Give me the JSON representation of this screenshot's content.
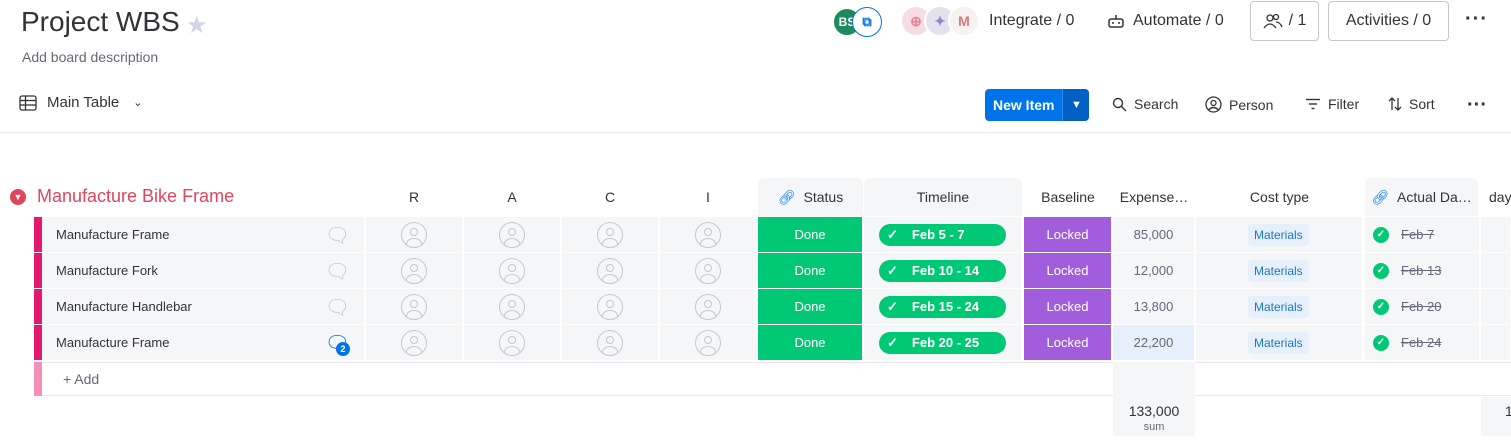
{
  "board": {
    "title": "Project WBS",
    "description": "Add board description"
  },
  "header": {
    "user_initials": "BS",
    "integrate_label": "Integrate / 0",
    "automate_label": "Automate / 0",
    "members_label": "/ 1",
    "activities_label": "Activities / 0"
  },
  "toolbar": {
    "view_label": "Main Table",
    "new_item_label": "New Item",
    "search_label": "Search",
    "person_label": "Person",
    "filter_label": "Filter",
    "sort_label": "Sort"
  },
  "group": {
    "title": "Manufacture Bike Frame",
    "color": "#e2445c",
    "columns": {
      "r": "R",
      "a": "A",
      "c": "C",
      "i": "I",
      "status": "Status",
      "timeline": "Timeline",
      "baseline": "Baseline",
      "expenses": "Expense…",
      "cost_type": "Cost type",
      "actual_date": "Actual Da…",
      "days": "day"
    },
    "rows": [
      {
        "name": "Manufacture Frame",
        "status": "Done",
        "timeline": "Feb 5 - 7",
        "baseline": "Locked",
        "expense": "85,000",
        "cost_type": "Materials",
        "actual_date": "Feb 7",
        "comments": ""
      },
      {
        "name": "Manufacture Fork",
        "status": "Done",
        "timeline": "Feb 10 - 14",
        "baseline": "Locked",
        "expense": "12,000",
        "cost_type": "Materials",
        "actual_date": "Feb 13",
        "comments": ""
      },
      {
        "name": "Manufacture Handlebar",
        "status": "Done",
        "timeline": "Feb 15 - 24",
        "baseline": "Locked",
        "expense": "13,800",
        "cost_type": "Materials",
        "actual_date": "Feb 20",
        "comments": ""
      },
      {
        "name": "Manufacture Frame",
        "status": "Done",
        "timeline": "Feb 20 - 25",
        "baseline": "Locked",
        "expense": "22,200",
        "cost_type": "Materials",
        "actual_date": "Feb 24",
        "comments": "2"
      }
    ],
    "add_label": "+ Add",
    "expense_sum": "133,000",
    "sum_label": "sum",
    "days_sum_partial": "1"
  },
  "colors": {
    "status_done": "#00c875",
    "baseline_locked": "#a25ddc",
    "primary": "#0073ea"
  }
}
